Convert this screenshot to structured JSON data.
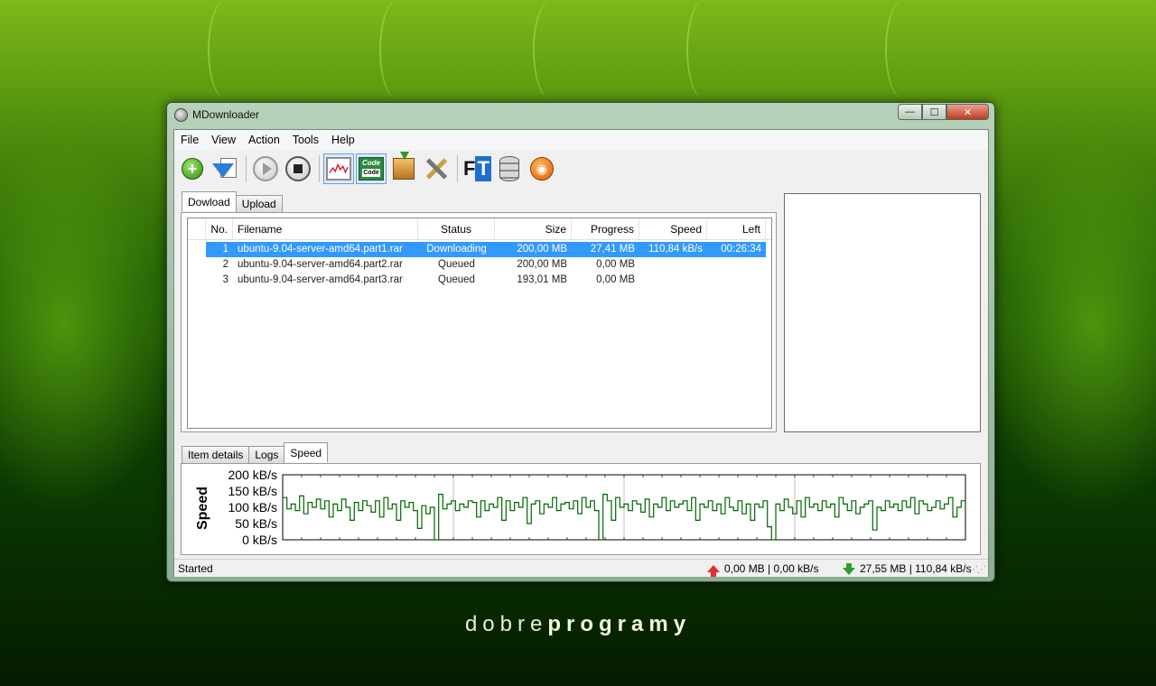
{
  "window": {
    "title": "MDownloader",
    "buttons": {
      "minimize": "—",
      "maximize": "☐",
      "close": "✕"
    }
  },
  "menu": [
    "File",
    "View",
    "Action",
    "Tools",
    "Help"
  ],
  "toolbar": [
    {
      "name": "add-download",
      "icon": "green-plus-icon"
    },
    {
      "name": "download-from-list",
      "icon": "download-arrow-icon"
    },
    {
      "name": "start",
      "icon": "play-icon"
    },
    {
      "name": "stop",
      "icon": "stop-icon"
    },
    {
      "name": "speed-graph",
      "icon": "graph-icon",
      "active": true
    },
    {
      "name": "code",
      "icon": "code-icon",
      "active": true,
      "label_top": "Code",
      "label_bottom": "Code"
    },
    {
      "name": "packages",
      "icon": "box-icon"
    },
    {
      "name": "settings",
      "icon": "tools-icon"
    },
    {
      "name": "file-transfer",
      "icon": "ft-icon",
      "label_f": "F",
      "label_t": "T"
    },
    {
      "name": "database",
      "icon": "database-icon"
    },
    {
      "name": "rss",
      "icon": "rss-icon"
    }
  ],
  "top_tabs": [
    "Dowload",
    "Upload"
  ],
  "table": {
    "columns": [
      "No.",
      "Filename",
      "Status",
      "Size",
      "Progress",
      "Speed",
      "Left"
    ],
    "rows": [
      {
        "no": "1",
        "filename": "ubuntu-9.04-server-amd64.part1.rar",
        "status": "Downloading",
        "size": "200,00 MB",
        "progress": "27,41 MB",
        "speed": "110,84 kB/s",
        "left": "00:26:34",
        "selected": true
      },
      {
        "no": "2",
        "filename": "ubuntu-9.04-server-amd64.part2.rar",
        "status": "Queued",
        "size": "200,00 MB",
        "progress": "0,00 MB",
        "speed": "",
        "left": ""
      },
      {
        "no": "3",
        "filename": "ubuntu-9.04-server-amd64.part3.rar",
        "status": "Queued",
        "size": "193,01 MB",
        "progress": "0,00 MB",
        "speed": "",
        "left": ""
      }
    ]
  },
  "bottom_tabs": [
    "Item details",
    "Logs",
    "Speed"
  ],
  "chart_data": {
    "type": "line",
    "ylabel": "Speed",
    "ylim": [
      0,
      200
    ],
    "y_ticks": [
      "200 kB/s",
      "150 kB/s",
      "100 kB/s",
      "50 kB/s",
      "0 kB/s"
    ],
    "y_tick_values": [
      200,
      150,
      100,
      50,
      0
    ],
    "color": "#006400",
    "values": [
      130,
      95,
      110,
      90,
      135,
      80,
      115,
      100,
      125,
      95,
      120,
      70,
      110,
      90,
      125,
      100,
      60,
      115,
      90,
      120,
      105,
      85,
      120,
      70,
      130,
      95,
      110,
      60,
      120,
      100,
      115,
      90,
      35,
      105,
      80,
      100,
      0,
      140,
      95,
      110,
      120,
      90,
      110,
      100,
      120,
      115,
      70,
      120,
      90,
      110,
      100,
      130,
      60,
      120,
      90,
      115,
      100,
      130,
      50,
      110,
      120,
      80,
      110,
      100,
      130,
      90,
      110,
      115,
      95,
      120,
      80,
      130,
      100,
      120,
      90,
      0,
      140,
      120,
      60,
      130,
      100,
      110,
      90,
      120,
      110,
      85,
      125,
      70,
      110,
      100,
      130,
      90,
      120,
      100,
      110,
      120,
      90,
      130,
      60,
      110,
      100,
      120,
      90,
      110,
      80,
      130,
      100,
      90,
      120,
      80,
      110,
      60,
      110,
      100,
      120,
      40,
      0,
      110,
      90,
      125,
      100,
      80,
      120,
      70,
      130,
      100,
      110,
      90,
      120,
      100,
      110,
      70,
      130,
      110,
      90,
      120,
      80,
      100,
      110,
      120,
      30,
      100,
      90,
      120,
      100,
      110,
      90,
      120,
      100,
      130,
      80,
      120,
      110,
      90,
      100,
      120,
      95,
      110,
      130,
      70,
      100,
      120
    ]
  },
  "status": {
    "left": "Started",
    "upload": "0,00 MB | 0,00 kB/s",
    "download": "27,55 MB | 110,84 kB/s"
  },
  "brand": {
    "part1": "dobre",
    "part2": "programy"
  }
}
